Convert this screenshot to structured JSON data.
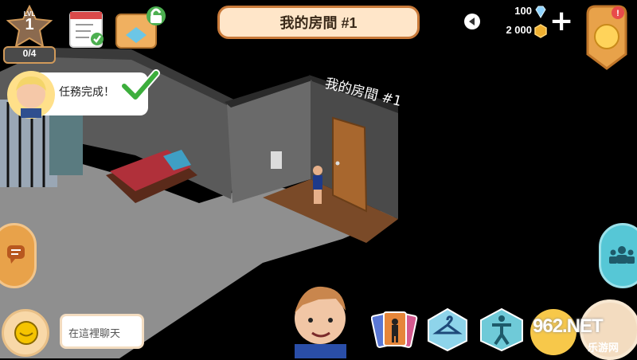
{
  "hud": {
    "level_label": "LVL",
    "level_number": "1",
    "level_progress": "0/4",
    "room_title": "我的房間 #1",
    "gems": "100",
    "coins": "2 000"
  },
  "quest": {
    "message": "任務完成！"
  },
  "room": {
    "wall_label": "我的房間 #1"
  },
  "chat": {
    "placeholder": "在這裡聊天"
  },
  "watermark": {
    "main": "962.NET",
    "sub": "乐游网"
  },
  "colors": {
    "accent_orange": "#e8a24a",
    "title_bg": "#ffe6c9",
    "title_border": "#c97a3a",
    "gem": "#8fd3ff",
    "coin": "#f0b030",
    "teal": "#56c7d6"
  },
  "icons": [
    "level-star-icon",
    "calendar-checklist-icon",
    "room-edit-icon",
    "back-arrow-icon",
    "gem-icon",
    "coin-icon",
    "plus-icon",
    "medal-icon",
    "check-icon",
    "chat-bubble-icon",
    "friends-icon",
    "chat-emoji-icon",
    "cards-icon",
    "hanger-icon",
    "pose-icon",
    "avatar-face-icon"
  ]
}
